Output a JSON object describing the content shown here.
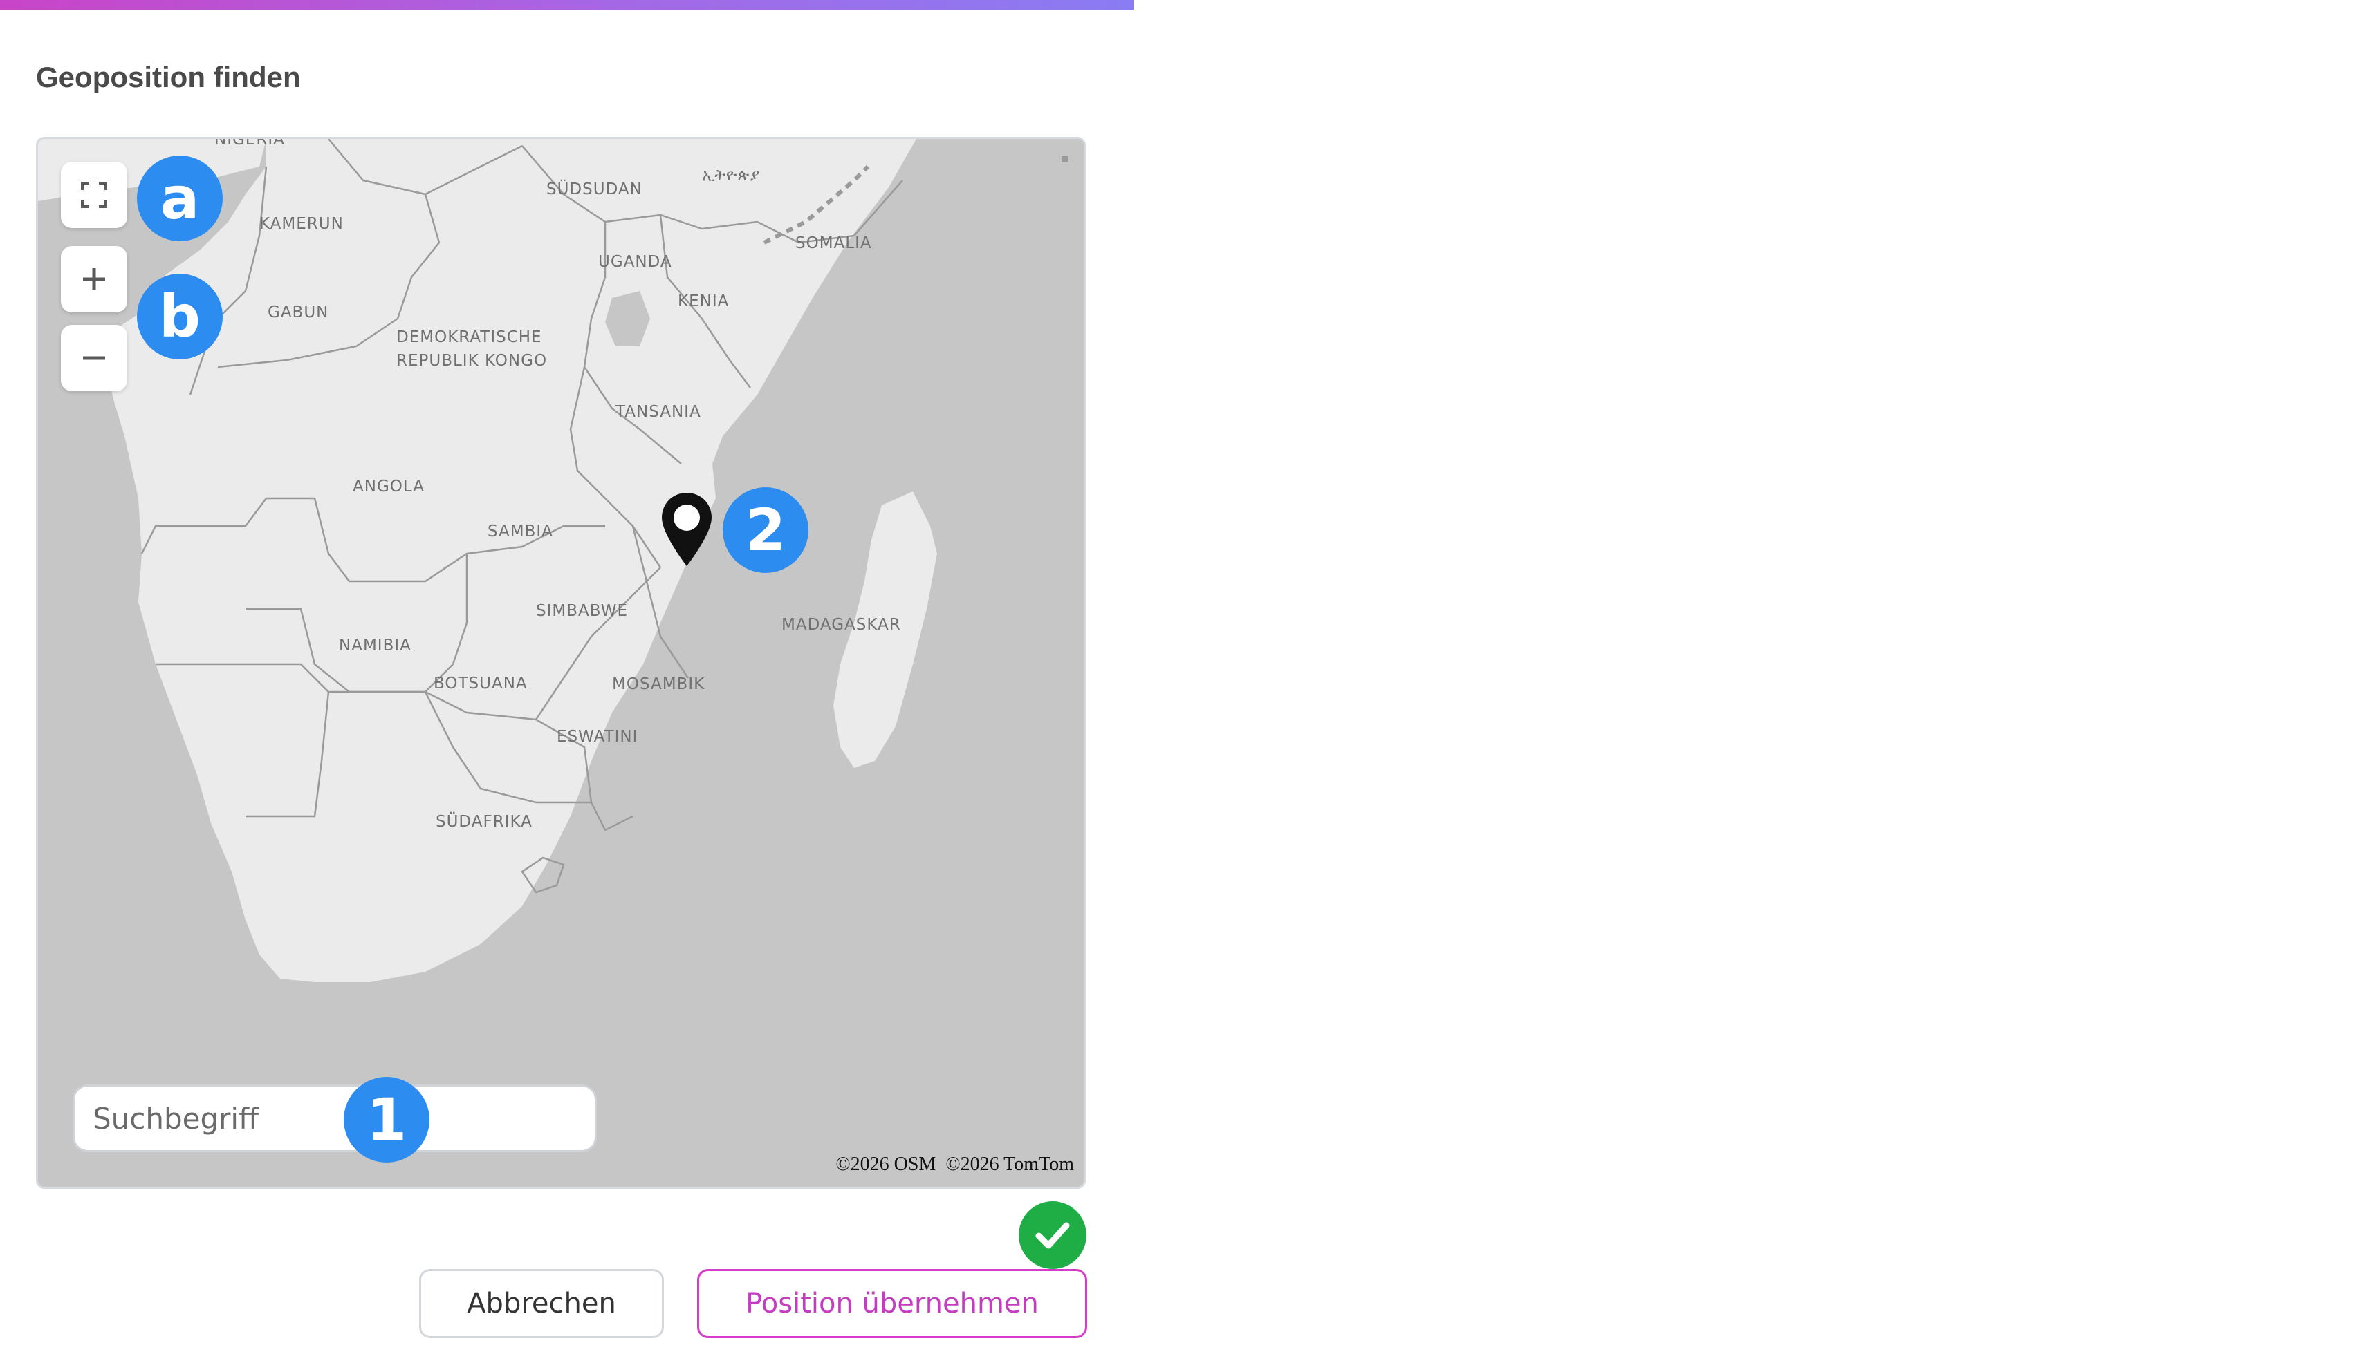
{
  "header": {
    "title": "Geoposition finden",
    "accent_gradient": [
      "#c944c8",
      "#8a7cf3"
    ]
  },
  "map": {
    "labels": {
      "nigeria": "NIGERIA",
      "kamerun": "KAMERUN",
      "gabun": "GABUN",
      "suedsudan": "SÜDSUDAN",
      "aethiopien": "ኢትዮጵያ",
      "somalia": "SOMALIA",
      "uganda": "UGANDA",
      "kenia": "KENIA",
      "drk_line1": "DEMOKRATISCHE",
      "drk_line2": "REPUBLIK KONGO",
      "tansania": "TANSANIA",
      "angola": "ANGOLA",
      "sambia": "SAMBIA",
      "simbabwe": "SIMBABWE",
      "namibia": "NAMIBIA",
      "botsuana": "BOTSUANA",
      "mosambik": "MOSAMBIK",
      "madagaskar": "MADAGASKAR",
      "eswatini": "ESWATINI",
      "suedafrika": "SÜDAFRIKA"
    },
    "controls": {
      "fullscreen_icon": "fullscreen-icon",
      "zoom_in_icon": "plus-icon",
      "zoom_out_icon": "minus-icon"
    },
    "marker_icon": "map-pin-icon",
    "search": {
      "placeholder": "Suchbegriff",
      "value": ""
    },
    "attribution": "©2026 OSM  ©2026 TomTom",
    "colors": {
      "land": "#ebebeb",
      "water": "#c6c6c6",
      "border": "#9a9a9a"
    }
  },
  "annotations": {
    "badge_a": "a",
    "badge_b": "b",
    "badge_1": "1",
    "badge_2": "2",
    "badge_color": "#2d8cf0",
    "check_color": "#1fae46",
    "check_icon": "check-icon"
  },
  "footer": {
    "cancel_label": "Abbrechen",
    "accept_label": "Position übernehmen",
    "accept_color": "#c43cc0"
  }
}
